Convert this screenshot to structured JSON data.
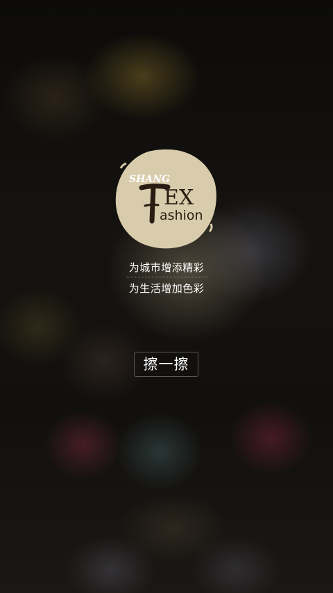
{
  "logo": {
    "brand_small": "SHANG",
    "brand_big": "EX",
    "brand_sub": "ashion",
    "brand_initials": "T",
    "brand_f": "F",
    "circle_color": "#d8ccac",
    "ink_color": "#2a1c12"
  },
  "slogans": {
    "line1": "为城市增添精彩",
    "line2": "为生活增加色彩"
  },
  "wipe_button": {
    "label": "擦一擦"
  }
}
